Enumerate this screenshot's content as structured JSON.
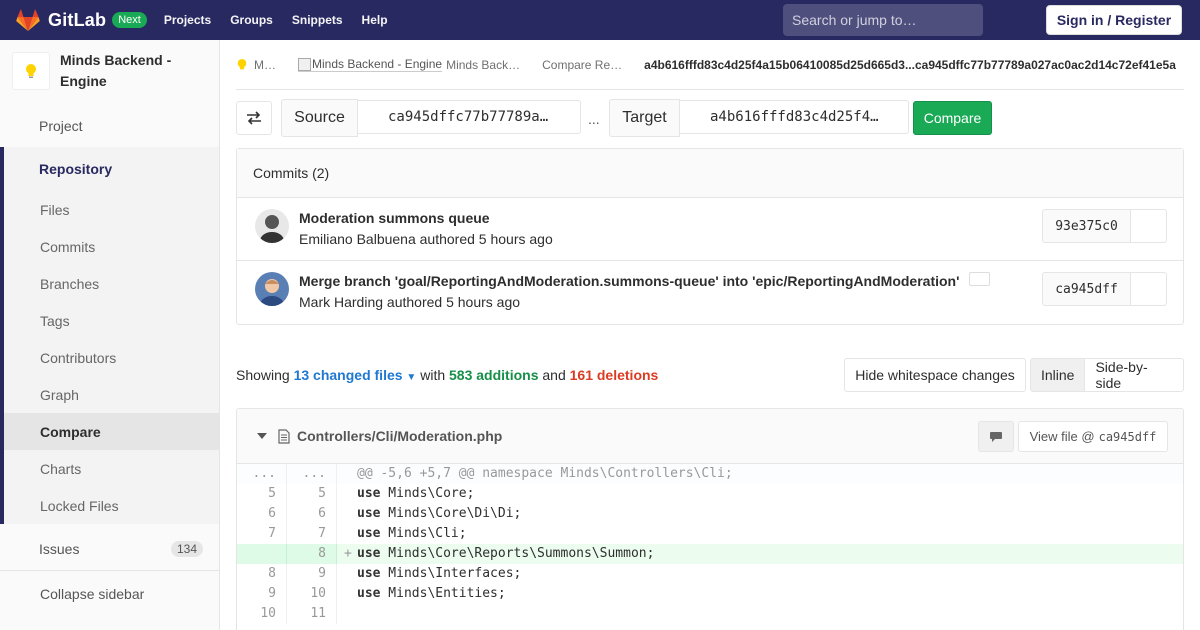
{
  "navbar": {
    "brand": "GitLab",
    "badge": "Next",
    "links": [
      "Projects",
      "Groups",
      "Snippets",
      "Help"
    ],
    "search_placeholder": "Search or jump to…",
    "signin_label": "Sign in / Register"
  },
  "sidebar": {
    "project_name": "Minds Backend - Engine",
    "project_item": "Project",
    "repository": {
      "label": "Repository",
      "items": [
        "Files",
        "Commits",
        "Branches",
        "Tags",
        "Contributors",
        "Graph",
        "Compare",
        "Charts",
        "Locked Files"
      ],
      "active": "Compare"
    },
    "issues_label": "Issues",
    "issues_count": "134",
    "collapse_label": "Collapse sidebar"
  },
  "breadcrumb": {
    "item1": "M…",
    "img_alt": "Minds Backend - Engine",
    "item2": "Minds Back…",
    "item3": "Compare Re…",
    "current": "a4b616fffd83c4d25f4a15b06410085d25d665d3...ca945dffc77b77789a027ac0ac2d14c72ef41e5a"
  },
  "compare": {
    "source_label": "Source",
    "source_ref": "ca945dffc77b77789a…",
    "separator": "...",
    "target_label": "Target",
    "target_ref": "a4b616fffd83c4d25f4…",
    "compare_button": "Compare"
  },
  "commits": {
    "header": "Commits (2)",
    "list": [
      {
        "title": "Moderation summons queue",
        "meta": "Emiliano Balbuena authored 5 hours ago",
        "sha": "93e375c0"
      },
      {
        "title": "Merge branch 'goal/ReportingAndModeration.summons-queue' into 'epic/ReportingAndModeration'",
        "meta": "Mark Harding authored 5 hours ago",
        "sha": "ca945dff"
      }
    ]
  },
  "stats": {
    "showing": "Showing",
    "files": "13 changed files",
    "with": "with",
    "additions": "583 additions",
    "and": "and",
    "deletions": "161 deletions",
    "whitespace_button": "Hide whitespace changes",
    "inline_button": "Inline",
    "side_button": "Side-by-side"
  },
  "file": {
    "path": "Controllers/Cli/Moderation.php",
    "view_file_label": "View file @",
    "view_file_sha": "ca945dff",
    "lines": [
      {
        "type": "hunk",
        "old": "...",
        "new": "...",
        "kw": "",
        "text": "@@ -5,6 +5,7 @@ namespace Minds\\Controllers\\Cli;"
      },
      {
        "type": "ctx",
        "old": "5",
        "new": "5",
        "kw": "use",
        "text": " Minds\\Core;"
      },
      {
        "type": "ctx",
        "old": "6",
        "new": "6",
        "kw": "use",
        "text": " Minds\\Core\\Di\\Di;"
      },
      {
        "type": "ctx",
        "old": "7",
        "new": "7",
        "kw": "use",
        "text": " Minds\\Cli;"
      },
      {
        "type": "new",
        "old": "",
        "new": "8",
        "kw": "use",
        "text": " Minds\\Core\\Reports\\Summons\\Summon;"
      },
      {
        "type": "ctx",
        "old": "8",
        "new": "9",
        "kw": "use",
        "text": " Minds\\Interfaces;"
      },
      {
        "type": "ctx",
        "old": "9",
        "new": "10",
        "kw": "use",
        "text": " Minds\\Entities;"
      },
      {
        "type": "ctx",
        "old": "10",
        "new": "11",
        "kw": "",
        "text": ""
      }
    ]
  },
  "colors": {
    "navbar": "#292961",
    "accent_green": "#1aaa55",
    "link_blue": "#1f78d1",
    "deletions_red": "#db3b21"
  }
}
